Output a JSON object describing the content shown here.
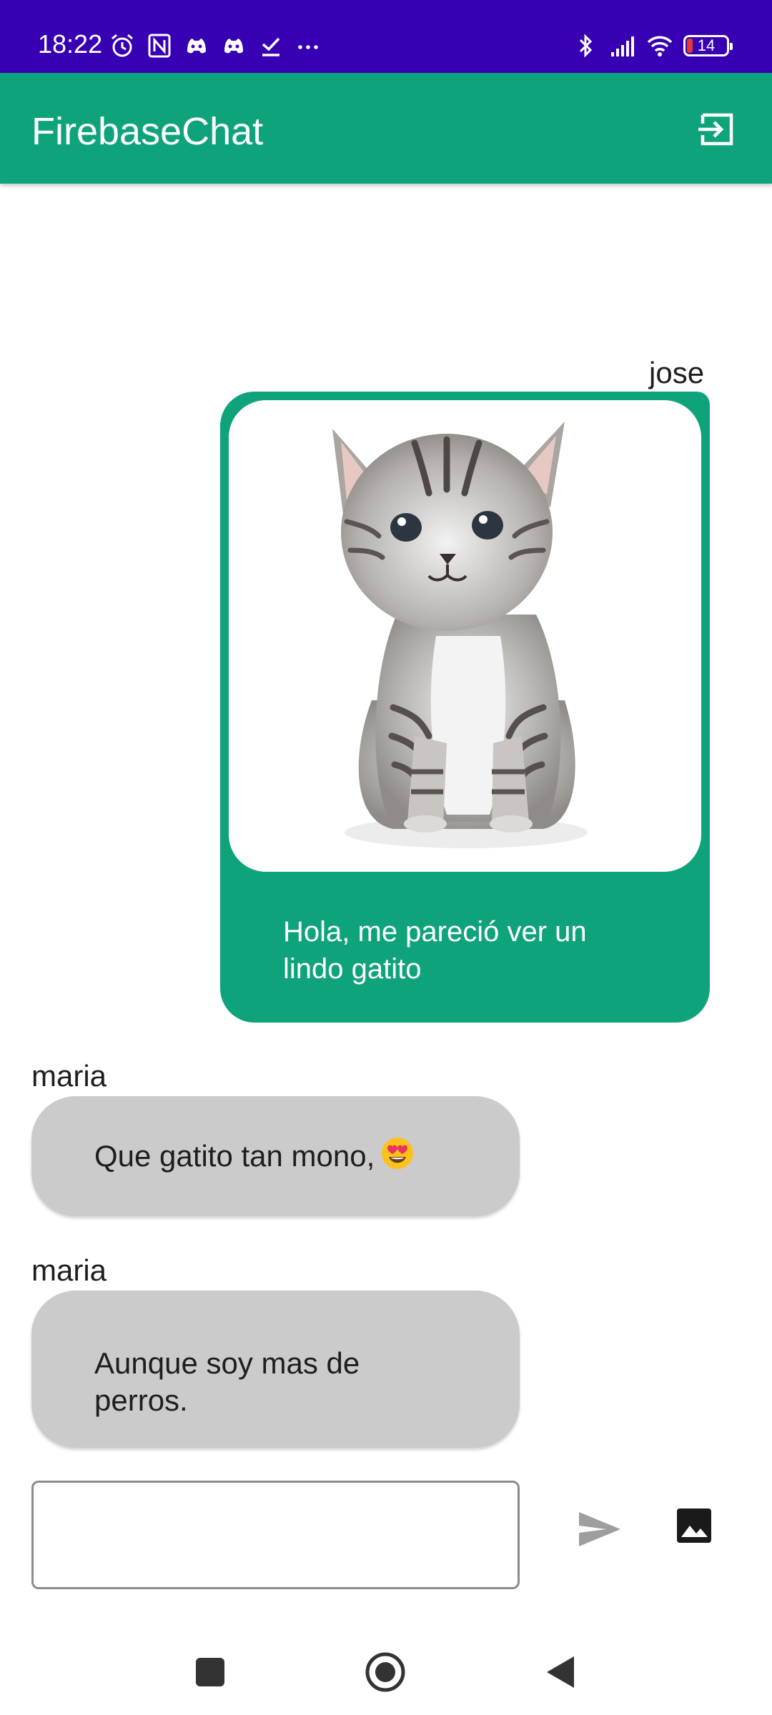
{
  "status_bar": {
    "time": "18:22",
    "battery_level": "14",
    "left_icons": [
      "alarm-icon",
      "nfc-icon",
      "discord-icon",
      "discord-icon",
      "check-download-icon",
      "more-dots-icon"
    ],
    "right_icons": [
      "bluetooth-icon",
      "signal-icon",
      "wifi-icon",
      "battery-icon"
    ],
    "background_color": "#3700b3"
  },
  "app_bar": {
    "title": "FirebaseChat",
    "action_icon": "logout-icon",
    "background_color": "#0fa37c"
  },
  "messages": [
    {
      "sender": "jose",
      "type": "sent",
      "image": "kitten-photo",
      "text": "Hola, me pareció ver un lindo gatito",
      "bubble_color": "#0fa37c"
    },
    {
      "sender": "maria",
      "type": "received",
      "text": "Que gatito tan mono,",
      "emoji": "heart-eyes-emoji",
      "bubble_color": "#cbcbcb"
    },
    {
      "sender": "maria",
      "type": "received",
      "text": "Aunque soy mas de perros.",
      "bubble_color": "#cbcbcb"
    }
  ],
  "composer": {
    "input_value": "",
    "placeholder": "",
    "send_icon": "send-icon",
    "image_icon": "image-icon"
  },
  "nav_bar": {
    "buttons": [
      "recents-square-icon",
      "home-circle-icon",
      "back-triangle-icon"
    ]
  }
}
